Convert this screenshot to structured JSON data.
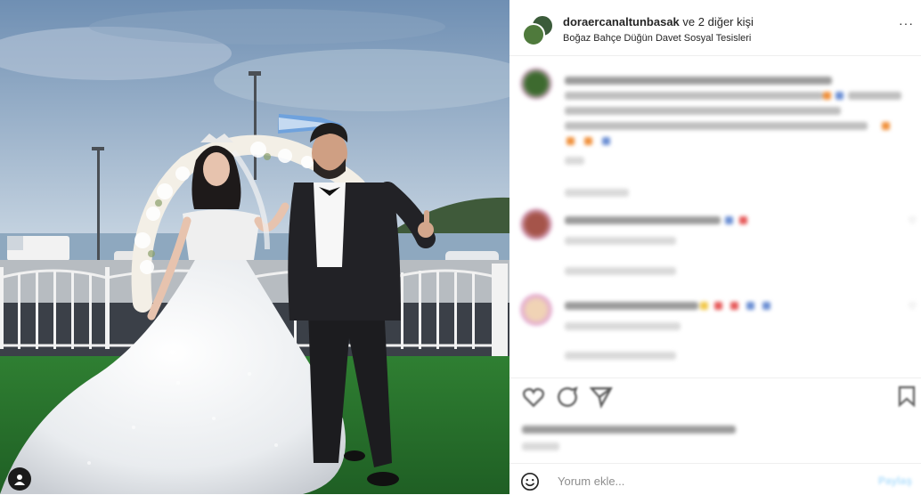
{
  "post": {
    "header": {
      "username": "doraercanaltunbasak",
      "and_others": "ve 2 diğer kişi",
      "location": "Boğaz Bahçe Düğün Davet Sosyal Tesisleri"
    },
    "comment_box": {
      "placeholder": "Yorum ekle...",
      "share_label": "Paylaş"
    },
    "icons": [
      "tagged-user-icon",
      "more-options-icon",
      "heart-icon",
      "comment-icon",
      "share-icon",
      "bookmark-icon",
      "emoji-icon"
    ],
    "colors": {
      "sky": "#8fa9c4",
      "grass": "#2d7a30",
      "accent_link": "#0095f6"
    }
  }
}
